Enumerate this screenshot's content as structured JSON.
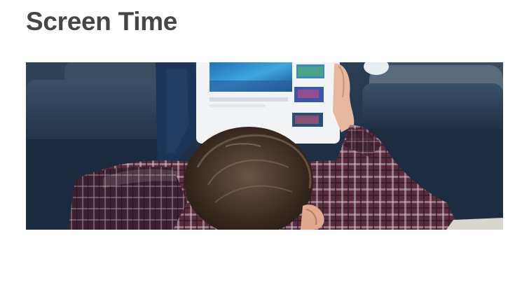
{
  "page": {
    "title": "Screen Time"
  },
  "hero_image": {
    "subject": "photo-boy-lying-on-sofa-using-tablet"
  },
  "colors": {
    "title": "#464646",
    "background": "#ffffff"
  }
}
